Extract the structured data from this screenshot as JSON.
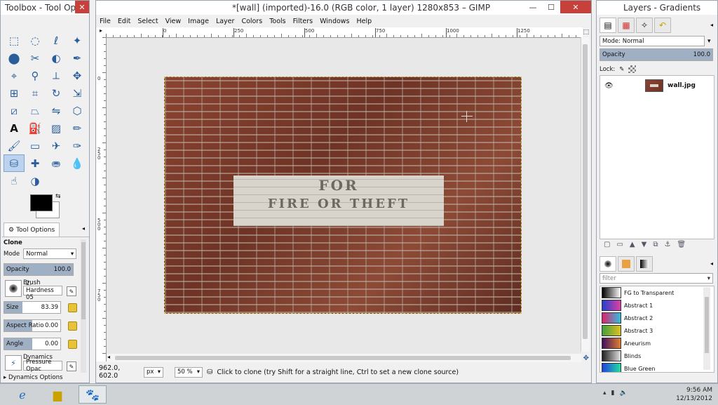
{
  "toolbox": {
    "title": "Toolbox - Tool Op...",
    "tab_label": "Tool Options",
    "tool_name": "Clone",
    "mode_label": "Mode",
    "mode_value": "Normal",
    "opacity_label": "Opacity",
    "opacity_value": "100.0",
    "opacity_level": 1.0,
    "brush_label": "Brush",
    "brush_value": "2. Hardness 05",
    "size_label": "Size",
    "size_value": "83.39",
    "size_level": 0.33,
    "aspect_label": "Aspect Ratio",
    "aspect_value": "0.00",
    "aspect_level": 0.5,
    "angle_label": "Angle",
    "angle_value": "0.00",
    "angle_level": 0.5,
    "dynamics_label": "Dynamics",
    "dynamics_value": "Pressure Opac",
    "dynamics_options_label": "Dynamics Options",
    "tool_icons": [
      "rect-select",
      "ellipse-select",
      "free-select",
      "fuzzy-select",
      "color-select",
      "scissors",
      "foreground-select",
      "paths",
      "color-picker",
      "zoom",
      "measure",
      "move",
      "align",
      "crop",
      "rotate",
      "scale",
      "shear",
      "perspective",
      "flip",
      "cage-transform",
      "text",
      "bucket-fill",
      "blend",
      "pencil",
      "paintbrush",
      "eraser",
      "airbrush",
      "ink",
      "clone",
      "heal",
      "perspective-clone",
      "blur",
      "smudge",
      "dodge-burn"
    ]
  },
  "main": {
    "title": "*[wall] (imported)-16.0 (RGB color, 1 layer) 1280x853 – GIMP",
    "menu": [
      "File",
      "Edit",
      "Select",
      "View",
      "Image",
      "Layer",
      "Colors",
      "Tools",
      "Filters",
      "Windows",
      "Help"
    ],
    "ruler_h": [
      "0",
      "250",
      "500",
      "750",
      "1000",
      "1250"
    ],
    "ruler_v": [
      "0",
      "2 5 0",
      "5 0 0",
      "7 5 0"
    ],
    "sign_line1": "FOR",
    "sign_line2": "FIRE OR THEFT",
    "coords": "962.0, 602.0",
    "unit": "px",
    "zoom": "50 %",
    "status_message": "Click to clone (try Shift for a straight line, Ctrl to set a new clone source)"
  },
  "layers": {
    "title": "Layers - Gradients",
    "mode_label": "Mode:",
    "mode_value": "Normal",
    "opacity_label": "Opacity",
    "opacity_value": "100.0",
    "opacity_level": 1.0,
    "lock_label": "Lock:",
    "layer_name": "wall.jpg",
    "filter_placeholder": "filter",
    "gradients": [
      {
        "name": "FG to Transparent",
        "colors": [
          "#000000",
          "#ffffff"
        ]
      },
      {
        "name": "Abstract 1",
        "colors": [
          "#2040d0",
          "#e040a0"
        ]
      },
      {
        "name": "Abstract 2",
        "colors": [
          "#e0206a",
          "#30c0e0"
        ]
      },
      {
        "name": "Abstract 3",
        "colors": [
          "#40a040",
          "#e0c020"
        ]
      },
      {
        "name": "Aneurism",
        "colors": [
          "#401060",
          "#e08030"
        ]
      },
      {
        "name": "Blinds",
        "colors": [
          "#202020",
          "#e0e0e0"
        ]
      },
      {
        "name": "Blue Green",
        "colors": [
          "#2040e0",
          "#20e0a0"
        ]
      }
    ]
  },
  "taskbar": {
    "time": "9:56 AM",
    "date": "12/13/2012"
  }
}
